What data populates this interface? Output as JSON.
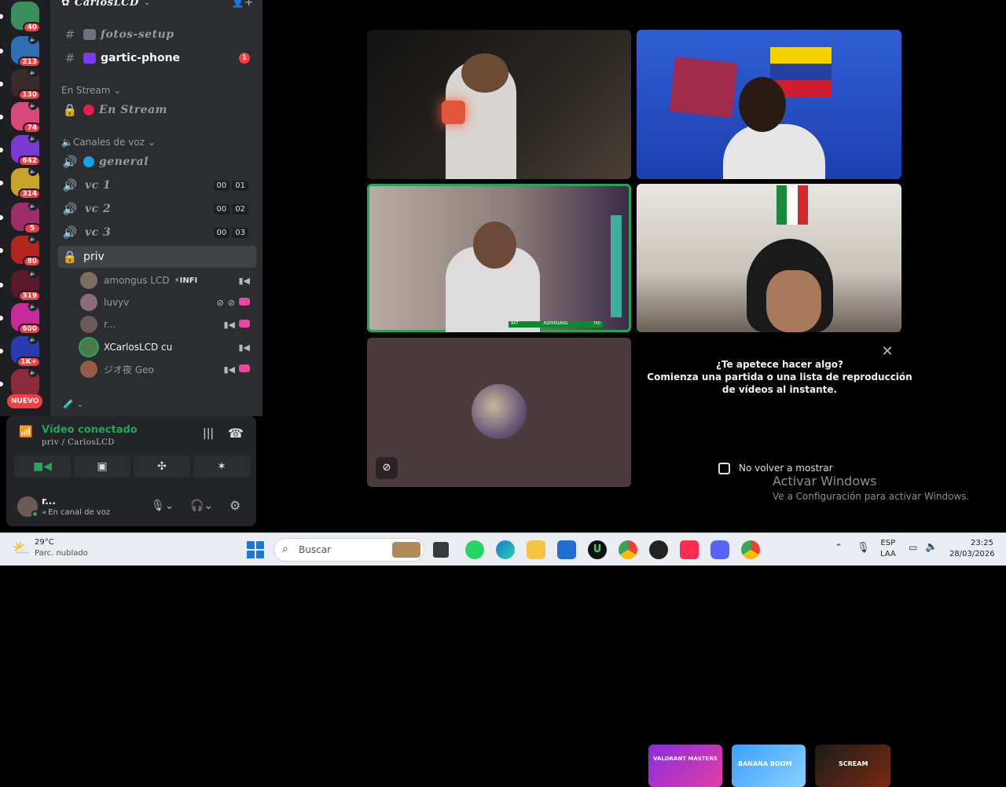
{
  "server_rail": {
    "servers": [
      {
        "name": "server-1",
        "badge": "40",
        "color": "#3a8f5c"
      },
      {
        "name": "server-2",
        "badge": "213",
        "color": "#2f6fb4"
      },
      {
        "name": "server-3",
        "badge": "130",
        "color": "#3b2a2a"
      },
      {
        "name": "server-4",
        "badge": "74",
        "color": "#d9487a"
      },
      {
        "name": "server-5",
        "badge": "642",
        "color": "#7a3ad1"
      },
      {
        "name": "server-6",
        "badge": "314",
        "color": "#c8a52a"
      },
      {
        "name": "server-7",
        "badge": "5",
        "color": "#9b2e6b"
      },
      {
        "name": "server-8",
        "badge": "80",
        "color": "#b3261e"
      },
      {
        "name": "server-9",
        "badge": "319",
        "color": "#5a1a2a"
      },
      {
        "name": "server-10",
        "badge": "600",
        "color": "#c72a9a"
      },
      {
        "name": "server-11",
        "badge": "1K+",
        "color": "#2a3ab0"
      },
      {
        "name": "server-12",
        "badge": "",
        "color": "#8a2a3a"
      }
    ],
    "new_label": "NUEVO"
  },
  "guild": {
    "name": "CarlosLCD"
  },
  "channels": {
    "text": [
      {
        "name": "fotos-setup",
        "emoji_color": "#6b7280",
        "style": "fancy"
      },
      {
        "name": "gartic-phone",
        "emoji_color": "#7c3aed",
        "style": "bright",
        "badge": "1"
      }
    ],
    "cat_stream": "En Stream",
    "stream_channel": "En Stream",
    "cat_voice": "Canales de voz",
    "voice": [
      {
        "name": "general"
      },
      {
        "name": "vc 1",
        "a": "00",
        "b": "01"
      },
      {
        "name": "vc 2",
        "a": "00",
        "b": "02"
      },
      {
        "name": "vc 3",
        "a": "00",
        "b": "03"
      }
    ],
    "priv": "priv",
    "members": [
      {
        "name": "amongus LCD",
        "tag": "INFI",
        "color": "#7b6f5f"
      },
      {
        "name": "luvyv",
        "color": "#8a6f7a"
      },
      {
        "name": "r...",
        "color": "#6b5a55"
      },
      {
        "name": "XCarlosLCD cu",
        "color": "#4a7a4a"
      },
      {
        "name": "ジオ夜 Geo",
        "color": "#9a5a4a"
      }
    ]
  },
  "voice_panel": {
    "status": "Vídeo conectado",
    "location": "priv / CarlosLCD"
  },
  "user_panel": {
    "name": "r...",
    "status": "En canal de voz"
  },
  "activity": {
    "title": "¿Te apetece hacer algo?",
    "body_1": "Comienza una partida o una lista de reproducción",
    "body_2": "de vídeos al instante.",
    "checkbox": "No volver a mostrar",
    "games": [
      {
        "name": "VALORANT MASTERS",
        "color": "#8a2be2"
      },
      {
        "name": "BANANA BOOM",
        "color": "#3aa0ff"
      },
      {
        "name": "SCREAM",
        "color": "#1b1b1b"
      }
    ]
  },
  "stream_overlay": {
    "left": "947",
    "mid": "ASEREGANG",
    "right": "760"
  },
  "watermark": {
    "title": "Activar Windows",
    "subtitle": "Ve a Configuración para activar Windows."
  },
  "taskbar": {
    "weather_temp": "29°C",
    "weather_desc": "Parc. nublado",
    "search_placeholder": "Buscar",
    "lang_1": "ESP",
    "lang_2": "LAA",
    "time": "23:25",
    "date": "28/03/2026"
  }
}
